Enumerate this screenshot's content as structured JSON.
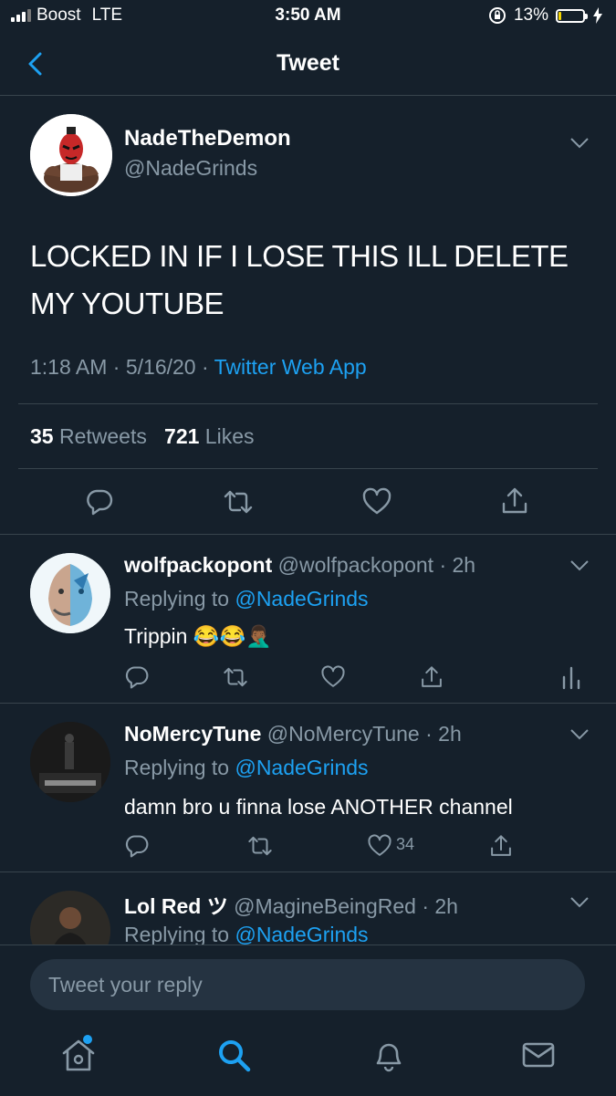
{
  "status_bar": {
    "carrier": "Boost",
    "network": "LTE",
    "time": "3:50 AM",
    "battery_percent": "13%",
    "battery_level": 0.13,
    "battery_color": "#f5d600"
  },
  "nav": {
    "title": "Tweet",
    "back_icon": "chevron-left-icon"
  },
  "tweet": {
    "name": "NadeTheDemon",
    "handle": "@NadeGrinds",
    "text": "LOCKED IN IF I LOSE THIS ILL DELETE MY YOUTUBE",
    "time": "1:18 AM",
    "sep1": "·",
    "date": "5/16/20",
    "sep2": "·",
    "source": "Twitter Web App",
    "retweets_count": "35",
    "retweets_label": "Retweets",
    "likes_count": "721",
    "likes_label": "Likes"
  },
  "replies": [
    {
      "name": "wolfpackopont",
      "handle": "@wolfpackopont",
      "time": "2h",
      "replying_label": "Replying to",
      "replying_to": "@NadeGrinds",
      "text": "Trippin 😂😂🤦🏾‍♂️",
      "likes": ""
    },
    {
      "name": "NoMercyTune",
      "handle": "@NoMercyTune",
      "time": "2h",
      "replying_label": "Replying to",
      "replying_to": "@NadeGrinds",
      "text": "damn bro u finna lose ANOTHER channel",
      "likes": "34"
    },
    {
      "name": "Lol Red ツ",
      "handle": "@MagineBeingRed",
      "time": "2h",
      "replying_label": "Replying to",
      "replying_to": "@NadeGrinds"
    }
  ],
  "composer": {
    "placeholder": "Tweet your reply"
  },
  "colors": {
    "background": "#15202b",
    "accent": "#1da1f2",
    "muted": "#8899a6",
    "divider": "#38444d"
  }
}
